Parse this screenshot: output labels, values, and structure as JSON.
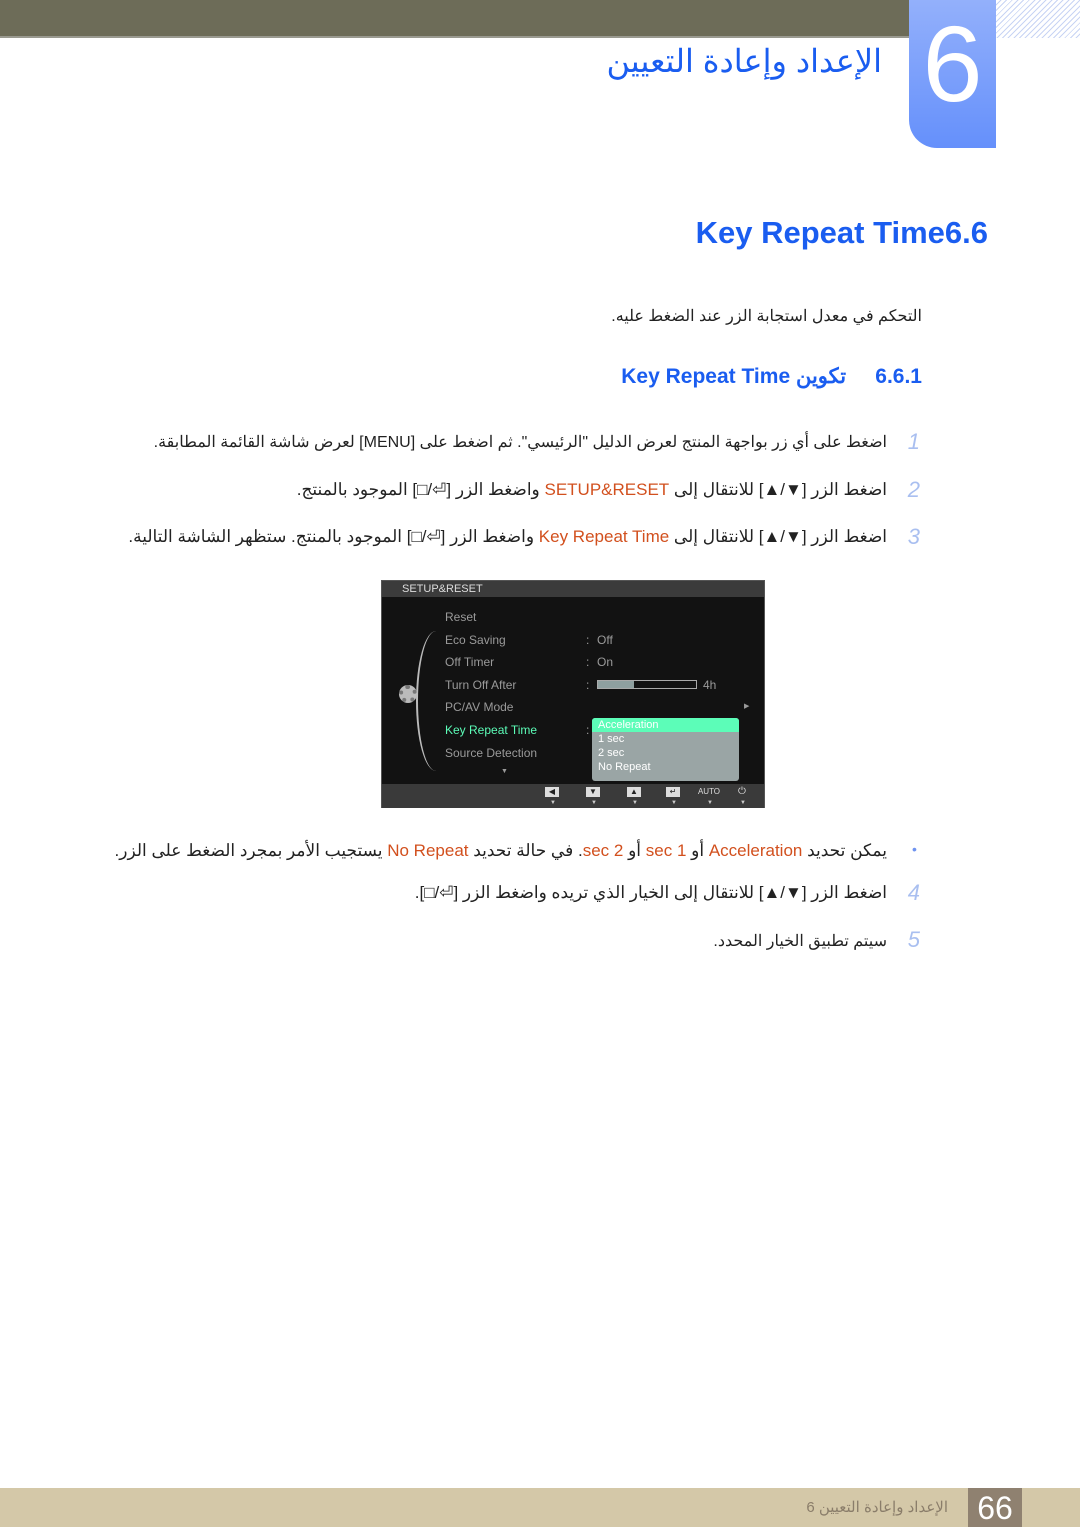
{
  "header": {
    "chapter_number": "6",
    "chapter_title": "الإعداد وإعادة التعيين"
  },
  "section": {
    "number": "6.6",
    "title": "Key Repeat Time",
    "intro": "التحكم في معدل استجابة الزر عند الضغط عليه."
  },
  "subsection": {
    "number": "6.6.1",
    "title": "تكوين Key Repeat Time"
  },
  "steps": [
    {
      "num": "1",
      "parts": [
        "اضغط على أي زر بواجهة المنتج لعرض الدليل \"الرئيسي\". ثم اضغط على [MENU] لعرض شاشة القائمة المطابقة."
      ]
    },
    {
      "num": "2",
      "parts": [
        "اضغط الزر [▼/▲] للانتقال إلى ",
        "SETUP&RESET",
        " واضغط الزر [⏎/□] الموجود بالمنتج."
      ]
    },
    {
      "num": "3",
      "parts": [
        "اضغط الزر [▼/▲] للانتقال إلى ",
        "Key Repeat Time",
        " واضغط الزر [⏎/□] الموجود بالمنتج. ستظهر الشاشة التالية."
      ]
    },
    {
      "num": "4",
      "parts": [
        "اضغط الزر [▼/▲] للانتقال إلى الخيار الذي تريده واضغط الزر [⏎/□]."
      ]
    },
    {
      "num": "5",
      "parts": [
        "سيتم تطبيق الخيار المحدد."
      ]
    }
  ],
  "bullet": {
    "parts": [
      "يمكن تحديد ",
      "Acceleration",
      " أو ",
      "1 sec",
      " أو ",
      "2 sec",
      ". في حالة تحديد ",
      "No Repeat",
      " يستجيب الأمر بمجرد الضغط على الزر."
    ]
  },
  "osd": {
    "title": "SETUP&RESET",
    "items": [
      "Reset",
      "Eco Saving",
      "Off Timer",
      "Turn Off After",
      "PC/AV Mode",
      "Key Repeat Time",
      "Source Detection"
    ],
    "values": {
      "eco": "Off",
      "timer": "On",
      "turn_off": "4h"
    },
    "turn_off_fraction": 0.37,
    "options": [
      "Acceleration",
      "1 sec",
      "2 sec",
      "No Repeat"
    ],
    "selected_color": "#5cfdb8",
    "active_item_color": "#5cfdb8",
    "buttons": [
      "◀",
      "▼",
      "▲",
      "↵",
      "AUTO",
      "⏻"
    ]
  },
  "footer": {
    "text": "الإعداد وإعادة التعيين 6",
    "page": "66"
  },
  "colors": {
    "accent": "#1a5df0",
    "highlight": "#d2501e"
  }
}
